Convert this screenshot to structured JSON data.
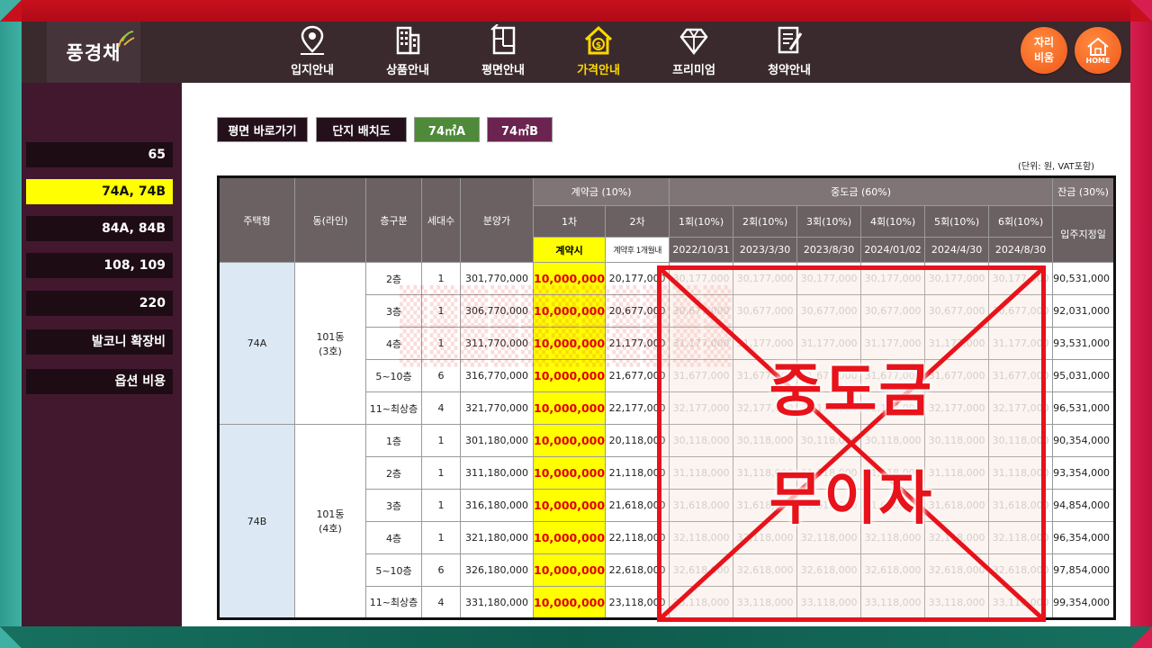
{
  "brand": {
    "logo_text": "풍경채"
  },
  "nav": {
    "items": [
      {
        "label": "입지안내",
        "icon": "map-pin-icon"
      },
      {
        "label": "상품안내",
        "icon": "building-icon"
      },
      {
        "label": "평면안내",
        "icon": "floorplan-icon"
      },
      {
        "label": "가격안내",
        "icon": "house-dollar-icon",
        "active": true
      },
      {
        "label": "프리미엄",
        "icon": "diamond-icon"
      },
      {
        "label": "청약안내",
        "icon": "document-pen-icon"
      }
    ],
    "seat_button": {
      "line1": "자리",
      "line2": "비움"
    },
    "home_button": "HOME"
  },
  "sidebar": {
    "items": [
      {
        "label": "65"
      },
      {
        "label": "74A, 74B",
        "active": true
      },
      {
        "label": "84A, 84B"
      },
      {
        "label": "108, 109"
      },
      {
        "label": "220"
      },
      {
        "label": "발코니 확장비"
      },
      {
        "label": "옵션 비용"
      }
    ]
  },
  "tabs": {
    "floorplan": "평면 바로가기",
    "site_plan": "단지 배치도",
    "type_a": "74㎡A",
    "type_b": "74㎡B"
  },
  "unit_note": "(단위: 원, VAT포함)",
  "table": {
    "headers": {
      "housing_type": "주택형",
      "dong": "동(라인)",
      "floor": "층구분",
      "households": "세대수",
      "price": "분양가",
      "deposit": "계약금 (10%)",
      "interim": "중도금 (60%)",
      "balance": "잔금 (30%)",
      "deposit_1": "1차",
      "deposit_2": "2차",
      "interim_rounds": [
        "1회(10%)",
        "2회(10%)",
        "3회(10%)",
        "4회(10%)",
        "5회(10%)",
        "6회(10%)"
      ],
      "deposit_1_when": "계약시",
      "deposit_2_when": "계약후 1개월내",
      "interim_dates": [
        "2022/10/31",
        "2023/3/30",
        "2023/8/30",
        "2024/01/02",
        "2024/4/30",
        "2024/8/30"
      ],
      "balance_when": "입주지정일"
    },
    "groups": [
      {
        "type": "74A",
        "dong_line1": "101동",
        "dong_line2": "(3호)",
        "rows": [
          {
            "floor": "2층",
            "households": "1",
            "price": "301,770,000",
            "dep1": "10,000,000",
            "dep2": "20,177,000",
            "interim": "30,177,000",
            "balance": "90,531,000"
          },
          {
            "floor": "3층",
            "households": "1",
            "price": "306,770,000",
            "dep1": "10,000,000",
            "dep2": "20,677,000",
            "interim": "30,677,000",
            "balance": "92,031,000"
          },
          {
            "floor": "4층",
            "households": "1",
            "price": "311,770,000",
            "dep1": "10,000,000",
            "dep2": "21,177,000",
            "interim": "31,177,000",
            "balance": "93,531,000"
          },
          {
            "floor": "5~10층",
            "households": "6",
            "price": "316,770,000",
            "dep1": "10,000,000",
            "dep2": "21,677,000",
            "interim": "31,677,000",
            "balance": "95,031,000"
          },
          {
            "floor": "11~최상층",
            "households": "4",
            "price": "321,770,000",
            "dep1": "10,000,000",
            "dep2": "22,177,000",
            "interim": "32,177,000",
            "balance": "96,531,000"
          }
        ]
      },
      {
        "type": "74B",
        "dong_line1": "101동",
        "dong_line2": "(4호)",
        "rows": [
          {
            "floor": "1층",
            "households": "1",
            "price": "301,180,000",
            "dep1": "10,000,000",
            "dep2": "20,118,000",
            "interim": "30,118,000",
            "balance": "90,354,000"
          },
          {
            "floor": "2층",
            "households": "1",
            "price": "311,180,000",
            "dep1": "10,000,000",
            "dep2": "21,118,000",
            "interim": "31,118,000",
            "balance": "93,354,000"
          },
          {
            "floor": "3층",
            "households": "1",
            "price": "316,180,000",
            "dep1": "10,000,000",
            "dep2": "21,618,000",
            "interim": "31,618,000",
            "balance": "94,854,000"
          },
          {
            "floor": "4층",
            "households": "1",
            "price": "321,180,000",
            "dep1": "10,000,000",
            "dep2": "22,118,000",
            "interim": "32,118,000",
            "balance": "96,354,000"
          },
          {
            "floor": "5~10층",
            "households": "6",
            "price": "326,180,000",
            "dep1": "10,000,000",
            "dep2": "22,618,000",
            "interim": "32,618,000",
            "balance": "97,854,000"
          },
          {
            "floor": "11~최상층",
            "households": "4",
            "price": "331,180,000",
            "dep1": "10,000,000",
            "dep2": "23,118,000",
            "interim": "33,118,000",
            "balance": "99,354,000"
          }
        ]
      }
    ]
  },
  "overlay": {
    "line1": "중도금",
    "line2": "무이자"
  },
  "colors": {
    "topbar": "#3a2a2e",
    "sidebar": "#42182f",
    "active_yellow": "#ffff00",
    "accent_red": "#e8121a",
    "button_orange": "#f0571c",
    "tab_green": "#4e8a3a",
    "tab_purple": "#6b2350"
  }
}
